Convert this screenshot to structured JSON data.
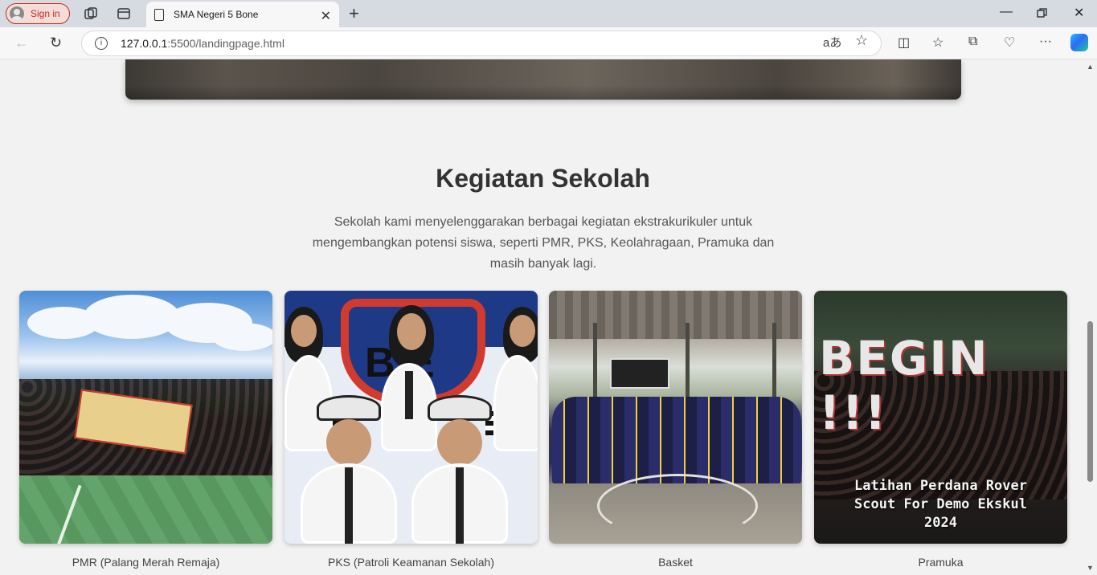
{
  "browser": {
    "sign_in_label": "Sign in",
    "tab_title": "SMA Negeri 5 Bone",
    "url_host": "127.0.0.1",
    "url_path": ":5500/landingpage.html"
  },
  "section": {
    "title": "Kegiatan Sekolah",
    "description": "Sekolah kami menyelenggarakan berbagai kegiatan ekstrakurikuler untuk mengembangkan potensi siswa, seperti PMR, PKS, Keolahragaan, Pramuka dan masih banyak lagi."
  },
  "activities": [
    {
      "caption": "PMR (Palang Merah Remaja)"
    },
    {
      "caption": "PKS (Patroli Keamanan Sekolah)",
      "photo_text": "B E"
    },
    {
      "caption": "Basket"
    },
    {
      "caption": "Pramuka",
      "photo_text": "BEGIN !!!",
      "overlay_lines": [
        "Latihan Perdana Rover",
        "Scout For Demo Ekskul",
        "2024"
      ]
    }
  ]
}
